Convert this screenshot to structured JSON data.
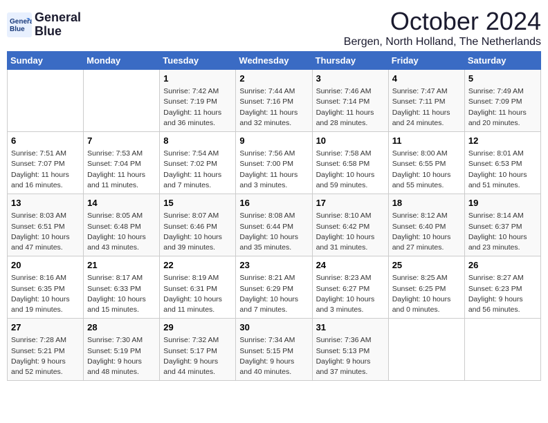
{
  "logo": {
    "line1": "General",
    "line2": "Blue"
  },
  "header": {
    "month": "October 2024",
    "location": "Bergen, North Holland, The Netherlands"
  },
  "weekdays": [
    "Sunday",
    "Monday",
    "Tuesday",
    "Wednesday",
    "Thursday",
    "Friday",
    "Saturday"
  ],
  "weeks": [
    [
      {
        "day": "",
        "info": ""
      },
      {
        "day": "",
        "info": ""
      },
      {
        "day": "1",
        "info": "Sunrise: 7:42 AM\nSunset: 7:19 PM\nDaylight: 11 hours and 36 minutes."
      },
      {
        "day": "2",
        "info": "Sunrise: 7:44 AM\nSunset: 7:16 PM\nDaylight: 11 hours and 32 minutes."
      },
      {
        "day": "3",
        "info": "Sunrise: 7:46 AM\nSunset: 7:14 PM\nDaylight: 11 hours and 28 minutes."
      },
      {
        "day": "4",
        "info": "Sunrise: 7:47 AM\nSunset: 7:11 PM\nDaylight: 11 hours and 24 minutes."
      },
      {
        "day": "5",
        "info": "Sunrise: 7:49 AM\nSunset: 7:09 PM\nDaylight: 11 hours and 20 minutes."
      }
    ],
    [
      {
        "day": "6",
        "info": "Sunrise: 7:51 AM\nSunset: 7:07 PM\nDaylight: 11 hours and 16 minutes."
      },
      {
        "day": "7",
        "info": "Sunrise: 7:53 AM\nSunset: 7:04 PM\nDaylight: 11 hours and 11 minutes."
      },
      {
        "day": "8",
        "info": "Sunrise: 7:54 AM\nSunset: 7:02 PM\nDaylight: 11 hours and 7 minutes."
      },
      {
        "day": "9",
        "info": "Sunrise: 7:56 AM\nSunset: 7:00 PM\nDaylight: 11 hours and 3 minutes."
      },
      {
        "day": "10",
        "info": "Sunrise: 7:58 AM\nSunset: 6:58 PM\nDaylight: 10 hours and 59 minutes."
      },
      {
        "day": "11",
        "info": "Sunrise: 8:00 AM\nSunset: 6:55 PM\nDaylight: 10 hours and 55 minutes."
      },
      {
        "day": "12",
        "info": "Sunrise: 8:01 AM\nSunset: 6:53 PM\nDaylight: 10 hours and 51 minutes."
      }
    ],
    [
      {
        "day": "13",
        "info": "Sunrise: 8:03 AM\nSunset: 6:51 PM\nDaylight: 10 hours and 47 minutes."
      },
      {
        "day": "14",
        "info": "Sunrise: 8:05 AM\nSunset: 6:48 PM\nDaylight: 10 hours and 43 minutes."
      },
      {
        "day": "15",
        "info": "Sunrise: 8:07 AM\nSunset: 6:46 PM\nDaylight: 10 hours and 39 minutes."
      },
      {
        "day": "16",
        "info": "Sunrise: 8:08 AM\nSunset: 6:44 PM\nDaylight: 10 hours and 35 minutes."
      },
      {
        "day": "17",
        "info": "Sunrise: 8:10 AM\nSunset: 6:42 PM\nDaylight: 10 hours and 31 minutes."
      },
      {
        "day": "18",
        "info": "Sunrise: 8:12 AM\nSunset: 6:40 PM\nDaylight: 10 hours and 27 minutes."
      },
      {
        "day": "19",
        "info": "Sunrise: 8:14 AM\nSunset: 6:37 PM\nDaylight: 10 hours and 23 minutes."
      }
    ],
    [
      {
        "day": "20",
        "info": "Sunrise: 8:16 AM\nSunset: 6:35 PM\nDaylight: 10 hours and 19 minutes."
      },
      {
        "day": "21",
        "info": "Sunrise: 8:17 AM\nSunset: 6:33 PM\nDaylight: 10 hours and 15 minutes."
      },
      {
        "day": "22",
        "info": "Sunrise: 8:19 AM\nSunset: 6:31 PM\nDaylight: 10 hours and 11 minutes."
      },
      {
        "day": "23",
        "info": "Sunrise: 8:21 AM\nSunset: 6:29 PM\nDaylight: 10 hours and 7 minutes."
      },
      {
        "day": "24",
        "info": "Sunrise: 8:23 AM\nSunset: 6:27 PM\nDaylight: 10 hours and 3 minutes."
      },
      {
        "day": "25",
        "info": "Sunrise: 8:25 AM\nSunset: 6:25 PM\nDaylight: 10 hours and 0 minutes."
      },
      {
        "day": "26",
        "info": "Sunrise: 8:27 AM\nSunset: 6:23 PM\nDaylight: 9 hours and 56 minutes."
      }
    ],
    [
      {
        "day": "27",
        "info": "Sunrise: 7:28 AM\nSunset: 5:21 PM\nDaylight: 9 hours and 52 minutes."
      },
      {
        "day": "28",
        "info": "Sunrise: 7:30 AM\nSunset: 5:19 PM\nDaylight: 9 hours and 48 minutes."
      },
      {
        "day": "29",
        "info": "Sunrise: 7:32 AM\nSunset: 5:17 PM\nDaylight: 9 hours and 44 minutes."
      },
      {
        "day": "30",
        "info": "Sunrise: 7:34 AM\nSunset: 5:15 PM\nDaylight: 9 hours and 40 minutes."
      },
      {
        "day": "31",
        "info": "Sunrise: 7:36 AM\nSunset: 5:13 PM\nDaylight: 9 hours and 37 minutes."
      },
      {
        "day": "",
        "info": ""
      },
      {
        "day": "",
        "info": ""
      }
    ]
  ]
}
